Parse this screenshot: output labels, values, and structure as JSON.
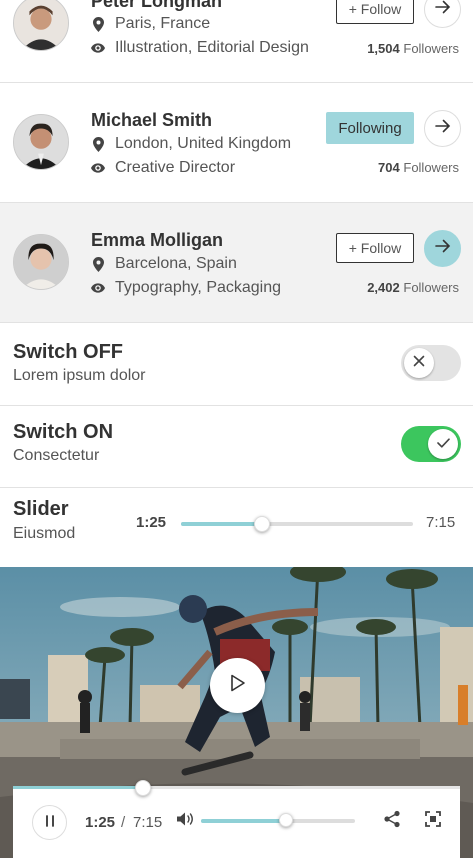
{
  "profiles": [
    {
      "name": "Peter Longman",
      "location": "Paris, France",
      "interests": "Illustration, Editorial Design",
      "follow_label": "+ Follow",
      "followers_count": "1,504",
      "followers_label": "Followers",
      "following": false,
      "highlighted": false
    },
    {
      "name": "Michael Smith",
      "location": "London, United Kingdom",
      "interests": "Creative Director",
      "follow_label": "Following",
      "followers_count": "704",
      "followers_label": "Followers",
      "following": true,
      "highlighted": false
    },
    {
      "name": "Emma Molligan",
      "location": "Barcelona, Spain",
      "interests": "Typography, Packaging",
      "follow_label": "+ Follow",
      "followers_count": "2,402",
      "followers_label": "Followers",
      "following": false,
      "highlighted": true
    }
  ],
  "switch_off": {
    "title": "Switch OFF",
    "subtitle": "Lorem ipsum dolor",
    "state": false
  },
  "switch_on": {
    "title": "Switch ON",
    "subtitle": "Consectetur",
    "state": true
  },
  "slider": {
    "title": "Slider",
    "subtitle": "Eiusmod",
    "current": "1:25",
    "total": "7:15",
    "fraction": 0.35
  },
  "video": {
    "current": "1:25",
    "separator": "/",
    "total": "7:15",
    "progress_fraction": 0.29,
    "volume_fraction": 0.55
  },
  "colors": {
    "accent": "#9fd6dc",
    "switch_on": "#3cc65e",
    "switch_off": "#e3e3e3",
    "highlight_row": "#f2f2f2"
  },
  "icons": {
    "location": "map-pin-icon",
    "interests": "eye-icon",
    "arrow": "arrow-right-icon",
    "play": "play-icon",
    "pause": "pause-icon",
    "volume": "volume-icon",
    "share": "share-icon",
    "fullscreen": "fullscreen-icon"
  }
}
